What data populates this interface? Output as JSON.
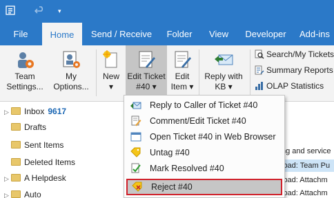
{
  "quick_access": {
    "undo_icon": "undo-icon",
    "customize_icon": "customize-icon"
  },
  "tabs": [
    "File",
    "Home",
    "Send / Receive",
    "Folder",
    "View",
    "Developer",
    "Add-ins"
  ],
  "ribbon": {
    "team_settings": {
      "line1": "Team",
      "line2": "Settings..."
    },
    "my_options": {
      "line1": "My",
      "line2": "Options..."
    },
    "new": {
      "line1": "New",
      "line2": "▾"
    },
    "edit_ticket": {
      "line1": "Edit Ticket",
      "line2": "#40 ▾"
    },
    "edit_item": {
      "line1": "Edit",
      "line2": "Item ▾"
    },
    "reply_kb": {
      "line1": "Reply with",
      "line2": "KB ▾"
    },
    "search_tickets": "Search/My Tickets...",
    "summary_reports": "Summary Reports",
    "olap_statistics": "OLAP Statistics"
  },
  "folders": [
    {
      "name": "Inbox",
      "count": "9617",
      "expander": "▷"
    },
    {
      "name": "Drafts",
      "count": "",
      "expander": ""
    },
    {
      "name": "Sent Items",
      "count": "",
      "expander": ""
    },
    {
      "name": "Deleted Items",
      "count": "",
      "expander": ""
    },
    {
      "name": "A Helpdesk",
      "count": "",
      "expander": "▷"
    },
    {
      "name": "Auto",
      "count": "",
      "expander": "▷"
    }
  ],
  "message_list": [
    "ng and service",
    "load: Team Pu",
    "load: Attachm",
    "load: Attachm"
  ],
  "menu": {
    "items": [
      "Reply to Caller of Ticket #40",
      "Comment/Edit Ticket #40",
      "Open Ticket #40 in Web Browser",
      "Untag #40",
      "Mark Resolved #40",
      "Reject #40"
    ],
    "highlighted_index": 5
  },
  "colors": {
    "accent": "#2b79c8",
    "highlight_border": "#d0202a"
  }
}
